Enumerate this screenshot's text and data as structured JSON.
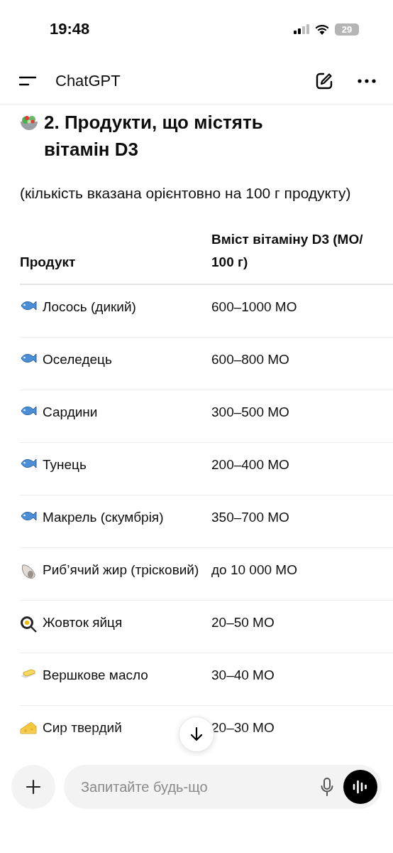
{
  "status_bar": {
    "time": "19:48",
    "battery": "29"
  },
  "header": {
    "title": "ChatGPT"
  },
  "message": {
    "heading": "2. Продукти, що містять вітамін D3",
    "note": "(кількість вказана орієнтовно на 100 г продукту)",
    "table": {
      "columns": [
        "Продукт",
        "Вміст вітаміну D3 (МО/ 100 г)"
      ],
      "rows": [
        {
          "kind": "fish",
          "product": "Лосось (дикий)",
          "amount": "600–1000 МО"
        },
        {
          "kind": "fish",
          "product": "Оселедець",
          "amount": "600–800 МО"
        },
        {
          "kind": "fish",
          "product": "Сардини",
          "amount": "300–500 МО"
        },
        {
          "kind": "fish",
          "product": "Тунець",
          "amount": "200–400 МО"
        },
        {
          "kind": "fish",
          "product": "Макрель (скумбрія)",
          "amount": "350–700 МО"
        },
        {
          "kind": "shell",
          "product": "Риб’ячий жир (трісковий)",
          "amount": "до 10 000 МО"
        },
        {
          "kind": "egg",
          "product": "Жовток яйця",
          "amount": "20–50 МО"
        },
        {
          "kind": "butter",
          "product": "Вершкове масло",
          "amount": "30–40 МО"
        },
        {
          "kind": "cheese",
          "product": "Сир твердий",
          "amount": "20–30 МО"
        }
      ]
    }
  },
  "composer": {
    "placeholder": "Запитайте будь-що"
  }
}
